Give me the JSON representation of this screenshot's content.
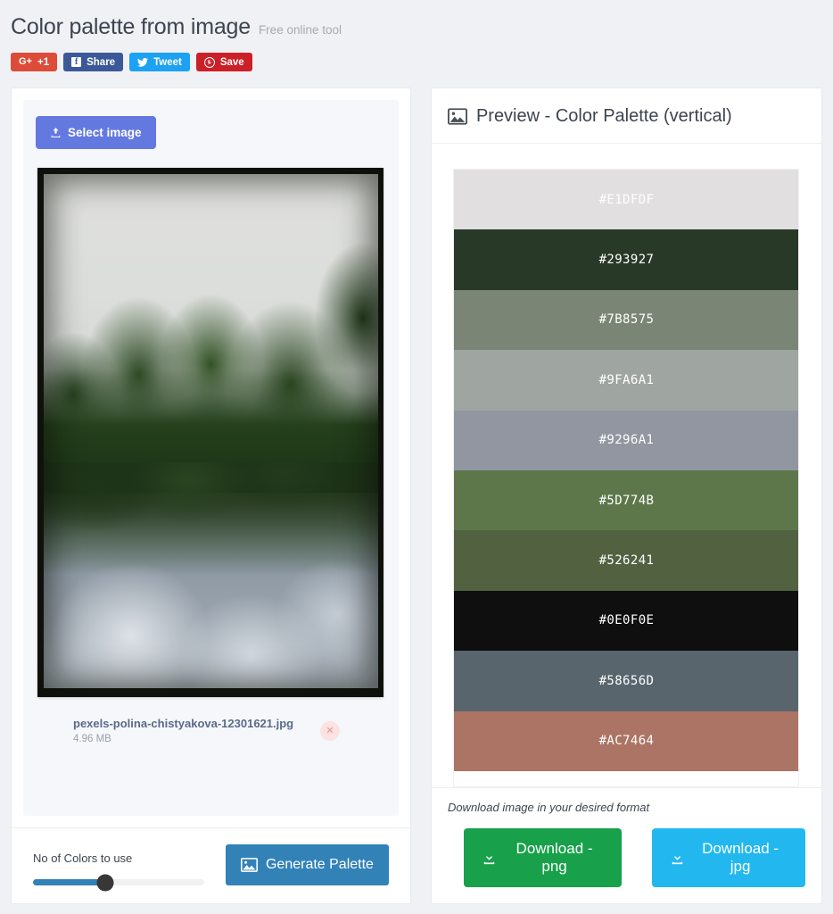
{
  "header": {
    "title": "Color palette from image",
    "subtitle": "Free online tool",
    "social_buttons": [
      {
        "id": "google-plus",
        "icon": "google-plus-icon",
        "glyph": "G+",
        "label": "+1",
        "color": "#dd4b39"
      },
      {
        "id": "facebook",
        "icon": "facebook-icon",
        "glyph": "f",
        "label": "Share",
        "color": "#3b5998"
      },
      {
        "id": "twitter",
        "icon": "twitter-icon",
        "glyph": "ᴠ",
        "label": "Tweet",
        "color": "#1da1f2"
      },
      {
        "id": "pinterest",
        "icon": "pinterest-icon",
        "glyph": "ⓟ",
        "label": "Save",
        "color": "#cb2027"
      }
    ]
  },
  "uploader": {
    "select_label": "Select image",
    "select_icon": "upload-icon",
    "select_color": "#6479e0",
    "file": {
      "name": "pexels-polina-chistyakova-12301621.jpg",
      "size": "4.96 MB",
      "remove_icon": "close-icon"
    }
  },
  "controls": {
    "slider_label": "No of Colors to use",
    "slider_percent": 42,
    "slider_fill_color": "#3282b8",
    "generate_label": "Generate Palette",
    "generate_icon": "image-icon",
    "generate_color": "#3282b8"
  },
  "preview": {
    "title": "Preview - Color Palette (vertical)",
    "title_icon": "image-icon",
    "swatches": [
      {
        "hex": "#E1DFDF",
        "label": "#E1DFDF"
      },
      {
        "hex": "#293927",
        "label": "#293927"
      },
      {
        "hex": "#7B8575",
        "label": "#7B8575"
      },
      {
        "hex": "#9FA6A1",
        "label": "#9FA6A1"
      },
      {
        "hex": "#9296A1",
        "label": "#9296A1"
      },
      {
        "hex": "#5D774B",
        "label": "#5D774B"
      },
      {
        "hex": "#526241",
        "label": "#526241"
      },
      {
        "hex": "#0E0F0E",
        "label": "#0E0F0E"
      },
      {
        "hex": "#58656D",
        "label": "#58656D"
      },
      {
        "hex": "#AC7464",
        "label": "#AC7464"
      }
    ]
  },
  "download": {
    "hint": "Download image in your desired format",
    "buttons": [
      {
        "id": "png",
        "label": "Download - png",
        "icon": "download-icon",
        "color": "#18a04a"
      },
      {
        "id": "jpg",
        "label": "Download - jpg",
        "icon": "download-icon",
        "color": "#22b8ef"
      }
    ]
  }
}
